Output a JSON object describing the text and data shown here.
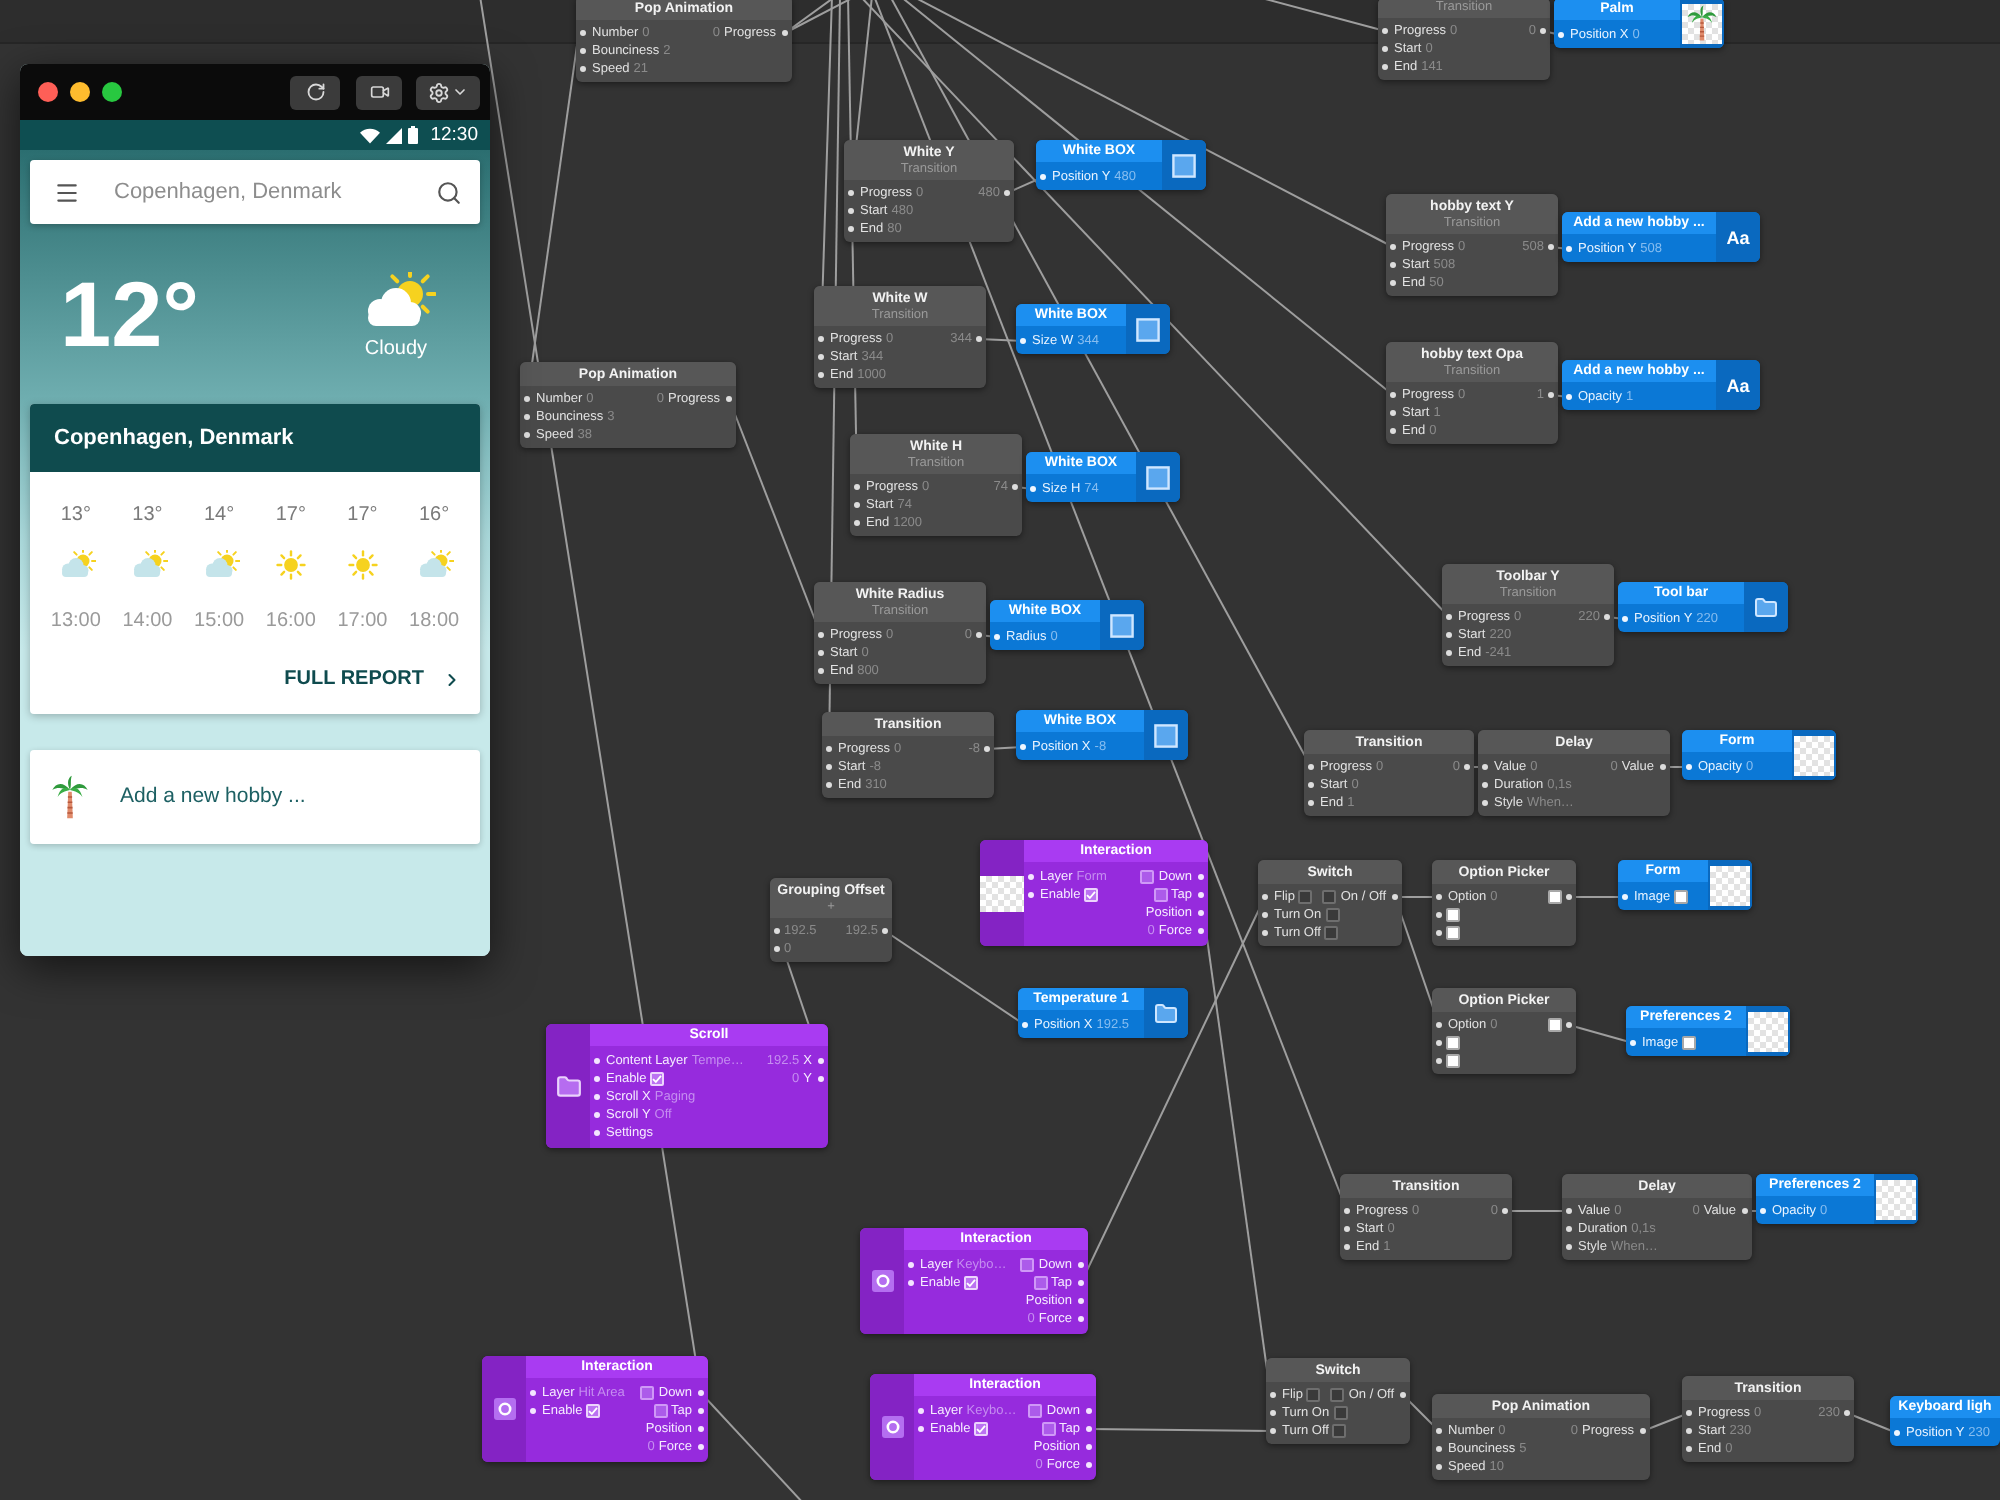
{
  "preview": {
    "status_bar": {
      "time": "12:30"
    },
    "search": {
      "placeholder": "Copenhagen, Denmark"
    },
    "current": {
      "temperature": "12°",
      "condition": "Cloudy"
    },
    "forecast": {
      "title": "Copenhagen, Denmark",
      "hours": [
        {
          "kind": "partly_cloudy",
          "temp": "13°",
          "time": "13:00"
        },
        {
          "kind": "partly_cloudy",
          "temp": "13°",
          "time": "14:00"
        },
        {
          "kind": "partly_cloudy",
          "temp": "14°",
          "time": "15:00"
        },
        {
          "kind": "sunny",
          "temp": "17°",
          "time": "16:00"
        },
        {
          "kind": "sunny",
          "temp": "17°",
          "time": "17:00"
        },
        {
          "kind": "partly_cloudy",
          "temp": "16°",
          "time": "18:00"
        }
      ],
      "link": "FULL REPORT"
    },
    "hobby": {
      "label": "Add a new hobby ..."
    }
  },
  "nodes": [
    {
      "kind": "patch",
      "title": "Pop Animation",
      "inputs": [
        {
          "kind": "value",
          "label": "Number",
          "value": "0"
        },
        {
          "kind": "value",
          "label": "Bounciness",
          "value": "2"
        },
        {
          "kind": "value",
          "label": "Speed",
          "value": "21"
        }
      ],
      "outputs": [
        {
          "kind": "value",
          "label": "Progress",
          "reading": "0"
        }
      ]
    },
    {
      "kind": "patch",
      "subtitle": "Transition",
      "inputs": [
        {
          "kind": "value",
          "label": "Progress",
          "value": "0"
        },
        {
          "kind": "value",
          "label": "Start",
          "value": "0"
        },
        {
          "kind": "value",
          "label": "End",
          "value": "141"
        }
      ],
      "outputs": [
        {
          "kind": "value",
          "reading": "0"
        }
      ]
    },
    {
      "kind": "layer",
      "title": "Palm",
      "inputs": [
        {
          "kind": "value",
          "label": "Position X",
          "value": "0"
        }
      ]
    },
    {
      "kind": "patch",
      "title": "White Y",
      "subtitle": "Transition",
      "inputs": [
        {
          "kind": "value",
          "label": "Progress",
          "value": "0"
        },
        {
          "kind": "value",
          "label": "Start",
          "value": "480"
        },
        {
          "kind": "value",
          "label": "End",
          "value": "80"
        }
      ],
      "outputs": [
        {
          "kind": "value",
          "reading": "480"
        }
      ]
    },
    {
      "kind": "layer",
      "title": "White BOX",
      "inputs": [
        {
          "kind": "value",
          "label": "Position Y",
          "value": "480"
        }
      ]
    },
    {
      "kind": "patch",
      "title": "hobby text Y",
      "subtitle": "Transition",
      "inputs": [
        {
          "kind": "value",
          "label": "Progress",
          "value": "0"
        },
        {
          "kind": "value",
          "label": "Start",
          "value": "508"
        },
        {
          "kind": "value",
          "label": "End",
          "value": "50"
        }
      ],
      "outputs": [
        {
          "kind": "value",
          "reading": "508"
        }
      ]
    },
    {
      "kind": "layer",
      "title": "Add a new hobby ...",
      "glyph": "Aa",
      "inputs": [
        {
          "kind": "value",
          "label": "Position Y",
          "value": "508"
        }
      ]
    },
    {
      "kind": "patch",
      "title": "White W",
      "subtitle": "Transition",
      "inputs": [
        {
          "kind": "value",
          "label": "Progress",
          "value": "0"
        },
        {
          "kind": "value",
          "label": "Start",
          "value": "344"
        },
        {
          "kind": "value",
          "label": "End",
          "value": "1000"
        }
      ],
      "outputs": [
        {
          "kind": "value",
          "reading": "344"
        }
      ]
    },
    {
      "kind": "layer",
      "title": "White BOX",
      "inputs": [
        {
          "kind": "value",
          "label": "Size W",
          "value": "344"
        }
      ]
    },
    {
      "kind": "patch",
      "title": "Pop Animation",
      "inputs": [
        {
          "kind": "value",
          "label": "Number",
          "value": "0"
        },
        {
          "kind": "value",
          "label": "Bounciness",
          "value": "3"
        },
        {
          "kind": "value",
          "label": "Speed",
          "value": "38"
        }
      ],
      "outputs": [
        {
          "kind": "value",
          "label": "Progress",
          "reading": "0"
        }
      ]
    },
    {
      "kind": "patch",
      "title": "hobby text Opa",
      "subtitle": "Transition",
      "inputs": [
        {
          "kind": "value",
          "label": "Progress",
          "value": "0"
        },
        {
          "kind": "value",
          "label": "Start",
          "value": "1"
        },
        {
          "kind": "value",
          "label": "End",
          "value": "0"
        }
      ],
      "outputs": [
        {
          "kind": "value",
          "reading": "1"
        }
      ]
    },
    {
      "kind": "layer",
      "title": "Add a new hobby ...",
      "glyph": "Aa",
      "inputs": [
        {
          "kind": "value",
          "label": "Opacity",
          "value": "1"
        }
      ]
    },
    {
      "kind": "patch",
      "title": "White H",
      "subtitle": "Transition",
      "inputs": [
        {
          "kind": "value",
          "label": "Progress",
          "value": "0"
        },
        {
          "kind": "value",
          "label": "Start",
          "value": "74"
        },
        {
          "kind": "value",
          "label": "End",
          "value": "1200"
        }
      ],
      "outputs": [
        {
          "kind": "value",
          "reading": "74"
        }
      ]
    },
    {
      "kind": "layer",
      "title": "White BOX",
      "inputs": [
        {
          "kind": "value",
          "label": "Size H",
          "value": "74"
        }
      ]
    },
    {
      "kind": "patch",
      "title": "White Radius",
      "subtitle": "Transition",
      "inputs": [
        {
          "kind": "value",
          "label": "Progress",
          "value": "0"
        },
        {
          "kind": "value",
          "label": "Start",
          "value": "0"
        },
        {
          "kind": "value",
          "label": "End",
          "value": "800"
        }
      ],
      "outputs": [
        {
          "kind": "value",
          "reading": "0"
        }
      ]
    },
    {
      "kind": "layer",
      "title": "White BOX",
      "inputs": [
        {
          "kind": "value",
          "label": "Radius",
          "value": "0"
        }
      ]
    },
    {
      "kind": "patch",
      "title": "Toolbar Y",
      "subtitle": "Transition",
      "inputs": [
        {
          "kind": "value",
          "label": "Progress",
          "value": "0"
        },
        {
          "kind": "value",
          "label": "Start",
          "value": "220"
        },
        {
          "kind": "value",
          "label": "End",
          "value": "-241"
        }
      ],
      "outputs": [
        {
          "kind": "value",
          "reading": "220"
        }
      ]
    },
    {
      "kind": "layer",
      "title": "Tool bar",
      "inputs": [
        {
          "kind": "value",
          "label": "Position Y",
          "value": "220"
        }
      ]
    },
    {
      "kind": "patch",
      "title": "Transition",
      "inputs": [
        {
          "kind": "value",
          "label": "Progress",
          "value": "0"
        },
        {
          "kind": "value",
          "label": "Start",
          "value": "-8"
        },
        {
          "kind": "value",
          "label": "End",
          "value": "310"
        }
      ],
      "outputs": [
        {
          "kind": "value",
          "reading": "-8"
        }
      ]
    },
    {
      "kind": "layer",
      "title": "White BOX",
      "inputs": [
        {
          "kind": "value",
          "label": "Position X",
          "value": "-8"
        }
      ]
    },
    {
      "kind": "patch",
      "title": "Transition",
      "inputs": [
        {
          "kind": "value",
          "label": "Progress",
          "value": "0"
        },
        {
          "kind": "value",
          "label": "Start",
          "value": "0"
        },
        {
          "kind": "value",
          "label": "End",
          "value": "1"
        }
      ],
      "outputs": [
        {
          "kind": "value",
          "reading": "0"
        }
      ]
    },
    {
      "kind": "patch",
      "title": "Delay",
      "inputs": [
        {
          "kind": "value",
          "label": "Value",
          "value": "0"
        },
        {
          "kind": "value",
          "label": "Duration",
          "value": "0,1s"
        },
        {
          "kind": "value",
          "label": "Style",
          "value": "When…"
        }
      ],
      "outputs": [
        {
          "kind": "value",
          "label": "Value",
          "reading": "0"
        }
      ]
    },
    {
      "kind": "layer",
      "title": "Form",
      "inputs": [
        {
          "kind": "value",
          "label": "Opacity",
          "value": "0"
        }
      ]
    },
    {
      "kind": "patch",
      "title": "Grouping Offset",
      "subtitle": "+",
      "inputs": [
        {
          "kind": "value",
          "value": "192.5"
        },
        {
          "kind": "value",
          "value": "0"
        }
      ],
      "outputs": [
        {
          "kind": "value",
          "reading": "192.5"
        }
      ]
    },
    {
      "kind": "interaction",
      "title": "Interaction",
      "inputs": [
        {
          "kind": "value",
          "label": "Layer",
          "value": "Form"
        },
        {
          "kind": "check",
          "label": "Enable",
          "checked": true
        }
      ],
      "outputs": [
        {
          "kind": "check",
          "label": "Down",
          "checked": false
        },
        {
          "kind": "check",
          "label": "Tap",
          "checked": false
        },
        {
          "kind": "value",
          "label": "Position"
        },
        {
          "kind": "value",
          "label": "Force",
          "reading": "0"
        }
      ]
    },
    {
      "kind": "patch",
      "title": "Switch",
      "inputs": [
        {
          "kind": "check",
          "label": "Flip",
          "checked": false
        },
        {
          "kind": "check",
          "label": "Turn On",
          "checked": false
        },
        {
          "kind": "check",
          "label": "Turn Off",
          "checked": false
        }
      ],
      "outputs": [
        {
          "kind": "check",
          "label": "On / Off",
          "checked": false
        }
      ]
    },
    {
      "kind": "patch",
      "title": "Option Picker",
      "inputs": [
        {
          "kind": "value",
          "label": "Option",
          "value": "0"
        },
        {
          "kind": "image"
        },
        {
          "kind": "image"
        }
      ],
      "outputs": [
        {
          "kind": "image"
        }
      ]
    },
    {
      "kind": "layer",
      "title": "Form",
      "inputs": [
        {
          "kind": "image",
          "label": "Image"
        }
      ]
    },
    {
      "kind": "interaction",
      "title": "Scroll",
      "inputs": [
        {
          "kind": "value",
          "label": "Content Layer",
          "value": "Tempe…"
        },
        {
          "kind": "check",
          "label": "Enable",
          "checked": true
        },
        {
          "kind": "value",
          "label": "Scroll X",
          "value": "Paging"
        },
        {
          "kind": "value",
          "label": "Scroll Y",
          "value": "Off"
        },
        {
          "kind": "value",
          "label": "Settings"
        }
      ],
      "outputs": [
        {
          "kind": "value",
          "label": "X",
          "reading": "192.5"
        },
        {
          "kind": "value",
          "label": "Y",
          "reading": "0"
        }
      ]
    },
    {
      "kind": "layer",
      "title": "Temperature 1",
      "inputs": [
        {
          "kind": "value",
          "label": "Position X",
          "value": "192.5"
        }
      ]
    },
    {
      "kind": "patch",
      "title": "Option Picker",
      "inputs": [
        {
          "kind": "value",
          "label": "Option",
          "value": "0"
        },
        {
          "kind": "image"
        },
        {
          "kind": "image"
        }
      ],
      "outputs": [
        {
          "kind": "image"
        }
      ]
    },
    {
      "kind": "layer",
      "title": "Preferences 2",
      "inputs": [
        {
          "kind": "image",
          "label": "Image"
        }
      ]
    },
    {
      "kind": "interaction",
      "title": "Interaction",
      "inputs": [
        {
          "kind": "value",
          "label": "Layer",
          "value": "Keybo…"
        },
        {
          "kind": "check",
          "label": "Enable",
          "checked": true
        }
      ],
      "outputs": [
        {
          "kind": "check",
          "label": "Down",
          "checked": false
        },
        {
          "kind": "check",
          "label": "Tap",
          "checked": false
        },
        {
          "kind": "value",
          "label": "Position"
        },
        {
          "kind": "value",
          "label": "Force",
          "reading": "0"
        }
      ]
    },
    {
      "kind": "patch",
      "title": "Transition",
      "inputs": [
        {
          "kind": "value",
          "label": "Progress",
          "value": "0"
        },
        {
          "kind": "value",
          "label": "Start",
          "value": "0"
        },
        {
          "kind": "value",
          "label": "End",
          "value": "1"
        }
      ],
      "outputs": [
        {
          "kind": "value",
          "reading": "0"
        }
      ]
    },
    {
      "kind": "patch",
      "title": "Delay",
      "inputs": [
        {
          "kind": "value",
          "label": "Value",
          "value": "0"
        },
        {
          "kind": "value",
          "label": "Duration",
          "value": "0,1s"
        },
        {
          "kind": "value",
          "label": "Style",
          "value": "When…"
        }
      ],
      "outputs": [
        {
          "kind": "value",
          "label": "Value",
          "reading": "0"
        }
      ]
    },
    {
      "kind": "layer",
      "title": "Preferences 2",
      "inputs": [
        {
          "kind": "value",
          "label": "Opacity",
          "value": "0"
        }
      ]
    },
    {
      "kind": "interaction",
      "title": "Interaction",
      "inputs": [
        {
          "kind": "value",
          "label": "Layer",
          "value": "Hit Area"
        },
        {
          "kind": "check",
          "label": "Enable",
          "checked": true
        }
      ],
      "outputs": [
        {
          "kind": "check",
          "label": "Down",
          "checked": false
        },
        {
          "kind": "check",
          "label": "Tap",
          "checked": false
        },
        {
          "kind": "value",
          "label": "Position"
        },
        {
          "kind": "value",
          "label": "Force",
          "reading": "0"
        }
      ]
    },
    {
      "kind": "interaction",
      "title": "Interaction",
      "inputs": [
        {
          "kind": "value",
          "label": "Layer",
          "value": "Keybo…"
        },
        {
          "kind": "check",
          "label": "Enable",
          "checked": true
        }
      ],
      "outputs": [
        {
          "kind": "check",
          "label": "Down",
          "checked": false
        },
        {
          "kind": "check",
          "label": "Tap",
          "checked": false
        },
        {
          "kind": "value",
          "label": "Position"
        },
        {
          "kind": "value",
          "label": "Force",
          "reading": "0"
        }
      ]
    },
    {
      "kind": "patch",
      "title": "Switch",
      "inputs": [
        {
          "kind": "check",
          "label": "Flip",
          "checked": false
        },
        {
          "kind": "check",
          "label": "Turn On",
          "checked": false
        },
        {
          "kind": "check",
          "label": "Turn Off",
          "checked": false
        }
      ],
      "outputs": [
        {
          "kind": "check",
          "label": "On / Off",
          "checked": false
        }
      ]
    },
    {
      "kind": "patch",
      "title": "Pop Animation",
      "inputs": [
        {
          "kind": "value",
          "label": "Number",
          "value": "0"
        },
        {
          "kind": "value",
          "label": "Bounciness",
          "value": "5"
        },
        {
          "kind": "value",
          "label": "Speed",
          "value": "10"
        }
      ],
      "outputs": [
        {
          "kind": "value",
          "label": "Progress",
          "reading": "0"
        }
      ]
    },
    {
      "kind": "patch",
      "title": "Transition",
      "inputs": [
        {
          "kind": "value",
          "label": "Progress",
          "value": "0"
        },
        {
          "kind": "value",
          "label": "Start",
          "value": "230"
        },
        {
          "kind": "value",
          "label": "End",
          "value": "0"
        }
      ],
      "outputs": [
        {
          "kind": "value",
          "reading": "230"
        }
      ]
    },
    {
      "kind": "layer",
      "title": "Keyboard ligh",
      "inputs": [
        {
          "kind": "value",
          "label": "Position Y",
          "value": "230"
        }
      ]
    }
  ]
}
